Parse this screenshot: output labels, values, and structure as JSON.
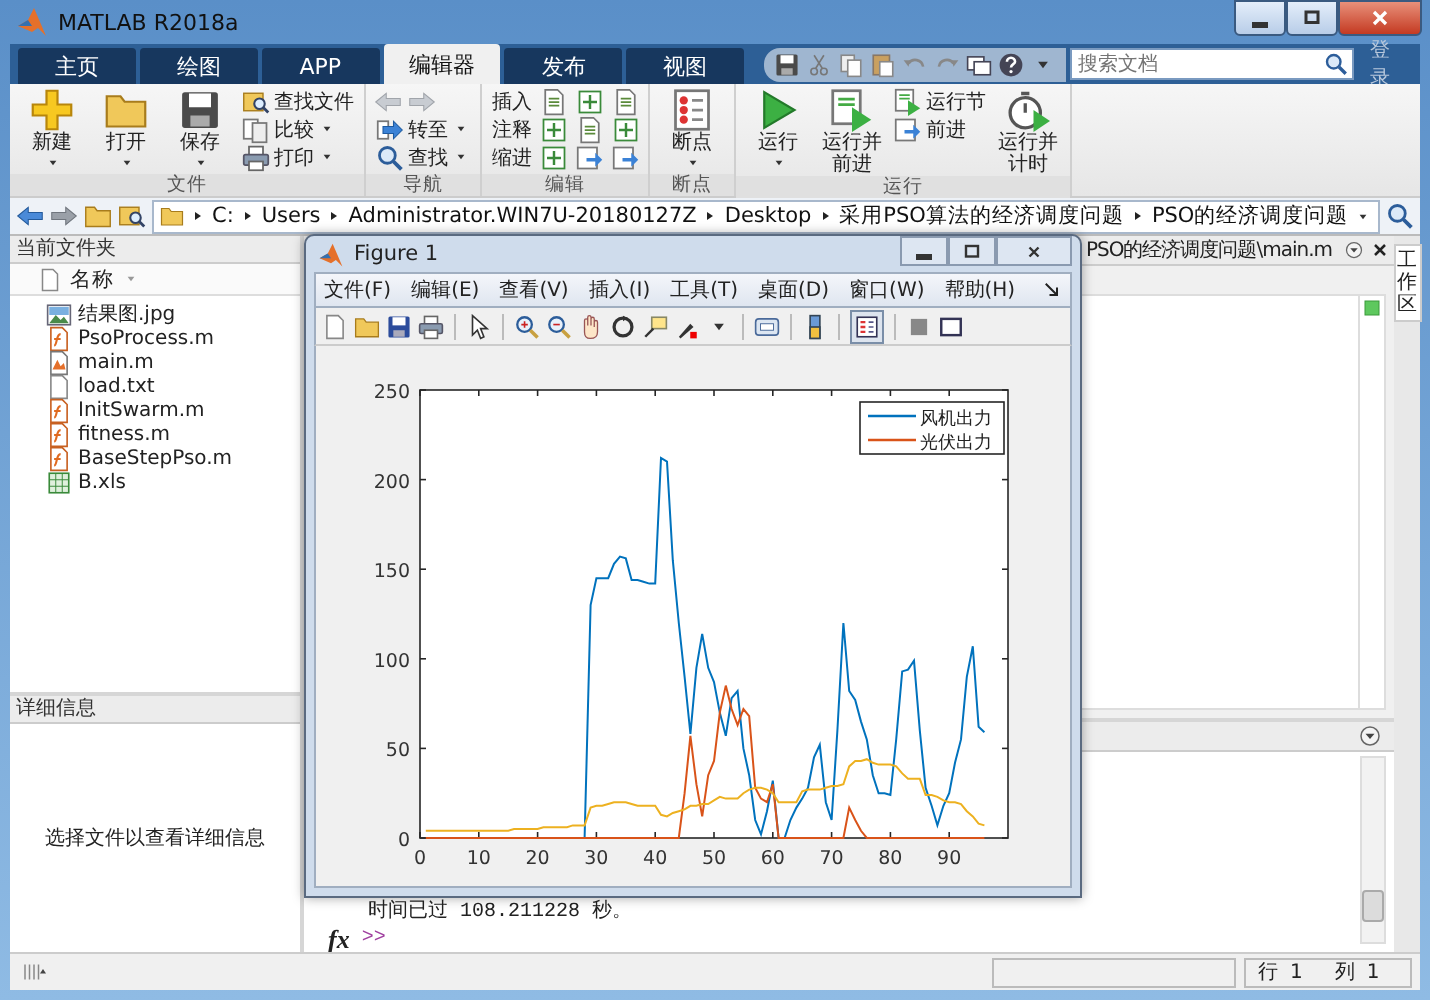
{
  "window": {
    "title": "MATLAB R2018a"
  },
  "tabs": [
    {
      "label": "主页",
      "selected": false
    },
    {
      "label": "绘图",
      "selected": false
    },
    {
      "label": "APP",
      "selected": false
    },
    {
      "label": "编辑器",
      "selected": true
    },
    {
      "label": "发布",
      "selected": false
    },
    {
      "label": "视图",
      "selected": false
    }
  ],
  "search": {
    "placeholder": "搜索文档"
  },
  "login": "登录",
  "ribbon": {
    "groups": [
      {
        "title": "文件",
        "buttons": [
          {
            "label": "新建",
            "kind": "large",
            "menu": true
          },
          {
            "label": "打开",
            "kind": "large",
            "menu": true
          },
          {
            "label": "保存",
            "kind": "large",
            "menu": true
          },
          {
            "label": "查找文件",
            "kind": "small",
            "menu": false
          },
          {
            "label": "比较",
            "kind": "small",
            "menu": true
          },
          {
            "label": "打印",
            "kind": "small",
            "menu": true
          }
        ]
      },
      {
        "title": "导航",
        "buttons": [
          {
            "label": "转至",
            "kind": "small",
            "menu": true
          },
          {
            "label": "查找",
            "kind": "small",
            "menu": true
          }
        ]
      },
      {
        "title": "编辑",
        "buttons": [
          {
            "label": "插入",
            "kind": "text",
            "menu": false
          },
          {
            "label": "注释",
            "kind": "text",
            "menu": false
          },
          {
            "label": "缩进",
            "kind": "text",
            "menu": false
          }
        ]
      },
      {
        "title": "断点",
        "buttons": [
          {
            "label": "断点",
            "kind": "large",
            "menu": true
          }
        ]
      },
      {
        "title": "运行",
        "buttons": [
          {
            "label": "运行",
            "kind": "large",
            "menu": true
          },
          {
            "label": "运行并前进",
            "kind": "large",
            "menu": false
          },
          {
            "label": "运行节",
            "kind": "small",
            "menu": false
          },
          {
            "label": "前进",
            "kind": "small",
            "menu": false
          },
          {
            "label": "运行并计时",
            "kind": "large",
            "menu": false
          }
        ]
      }
    ]
  },
  "address": [
    "C:",
    "Users",
    "Administrator.WIN7U-20180127Z",
    "Desktop",
    "采用PSO算法的经济调度问题",
    "PSO的经济调度问题"
  ],
  "current_folder": {
    "title": "当前文件夹",
    "column": "名称",
    "files": [
      {
        "name": "结果图.jpg",
        "kind": "image"
      },
      {
        "name": "PsoProcess.m",
        "kind": "function"
      },
      {
        "name": "main.m",
        "kind": "script"
      },
      {
        "name": "load.txt",
        "kind": "text"
      },
      {
        "name": "InitSwarm.m",
        "kind": "function"
      },
      {
        "name": "fitness.m",
        "kind": "function"
      },
      {
        "name": "BaseStepPso.m",
        "kind": "function"
      },
      {
        "name": "B.xls",
        "kind": "sheet"
      }
    ]
  },
  "details": {
    "title": "详细信息",
    "message": "选择文件以查看详细信息"
  },
  "editor": {
    "title": "PSO的经济调度问题\\main.m"
  },
  "workspace_tab": "工作区",
  "command_window": {
    "lines": [
      "时间已过 108.211228 秒。"
    ],
    "fx": "fx",
    "prompt": ">>"
  },
  "status_bar": {
    "row_label": "行",
    "row": "1",
    "col_label": "列",
    "col": "1"
  },
  "figure": {
    "title": "Figure 1",
    "menu": [
      "文件(F)",
      "编辑(E)",
      "查看(V)",
      "插入(I)",
      "工具(T)",
      "桌面(D)",
      "窗口(W)",
      "帮助(H)"
    ],
    "legend_button": {
      "selected": true
    },
    "chart_data": {
      "type": "line",
      "x": [
        1,
        2,
        3,
        4,
        5,
        6,
        7,
        8,
        9,
        10,
        11,
        12,
        13,
        14,
        15,
        16,
        17,
        18,
        19,
        20,
        21,
        22,
        23,
        24,
        25,
        26,
        27,
        28,
        29,
        30,
        31,
        32,
        33,
        34,
        35,
        36,
        37,
        38,
        39,
        40,
        41,
        42,
        43,
        44,
        45,
        46,
        47,
        48,
        49,
        50,
        51,
        52,
        53,
        54,
        55,
        56,
        57,
        58,
        59,
        60,
        61,
        62,
        63,
        64,
        65,
        66,
        67,
        68,
        69,
        70,
        71,
        72,
        73,
        74,
        75,
        76,
        77,
        78,
        79,
        80,
        81,
        82,
        83,
        84,
        85,
        86,
        87,
        88,
        89,
        90,
        91,
        92,
        93,
        94,
        95,
        96
      ],
      "series": [
        {
          "name": "风机出力",
          "color": "#0072bd",
          "values": [
            null,
            null,
            null,
            null,
            null,
            null,
            null,
            null,
            null,
            null,
            null,
            null,
            null,
            null,
            null,
            null,
            null,
            null,
            null,
            null,
            null,
            null,
            null,
            null,
            null,
            null,
            null,
            0,
            130,
            145,
            145,
            145,
            153,
            157,
            156,
            144,
            144,
            143,
            142,
            142,
            212,
            210,
            155,
            120,
            90,
            58,
            95,
            114,
            95,
            87,
            70,
            57,
            78,
            82,
            50,
            35,
            10,
            2,
            15,
            32,
            0,
            0,
            10,
            17,
            22,
            28,
            45,
            52,
            20,
            10,
            60,
            120,
            82,
            77,
            65,
            55,
            35,
            25,
            25,
            24,
            55,
            93,
            94,
            99,
            60,
            28,
            18,
            7,
            18,
            25,
            42,
            55,
            90,
            107,
            62,
            59
          ]
        },
        {
          "name": "光伏出力",
          "color": "#d95319",
          "values": [
            0,
            0,
            0,
            0,
            0,
            0,
            0,
            0,
            0,
            0,
            0,
            0,
            0,
            0,
            0,
            0,
            0,
            0,
            0,
            0,
            0,
            0,
            0,
            0,
            0,
            0,
            0,
            0,
            0,
            0,
            0,
            0,
            0,
            0,
            0,
            0,
            0,
            0,
            0,
            0,
            0,
            0,
            0,
            0,
            25,
            57,
            30,
            12,
            35,
            43,
            70,
            85,
            72,
            63,
            72,
            68,
            28,
            22,
            20,
            30,
            0,
            0,
            0,
            0,
            0,
            0,
            0,
            0,
            0,
            0,
            0,
            0,
            17,
            10,
            4,
            0,
            0,
            0,
            0,
            0,
            0,
            0,
            0,
            0,
            0,
            0,
            0,
            0,
            0,
            0,
            0,
            0,
            0,
            0,
            0,
            0
          ]
        },
        {
          "color": "#edb120",
          "values": [
            4,
            4,
            4,
            4,
            4,
            4,
            4,
            4,
            4,
            4,
            4,
            4,
            4,
            4,
            4,
            5,
            5,
            5,
            5,
            5,
            6,
            6,
            6,
            6,
            6,
            7,
            7,
            7,
            17,
            18,
            18,
            19,
            20,
            20,
            20,
            19,
            18,
            18,
            18,
            18,
            13,
            12,
            14,
            15,
            16,
            18,
            18,
            19,
            19,
            21,
            23,
            22,
            22,
            22,
            25,
            27,
            28,
            28,
            27,
            25,
            20,
            20,
            20,
            20,
            26,
            27,
            27,
            27,
            28,
            29,
            29,
            30,
            40,
            43,
            43,
            44,
            42,
            41,
            41,
            41,
            40,
            36,
            33,
            33,
            33,
            24,
            24,
            23,
            21,
            20,
            20,
            19,
            15,
            12,
            8,
            7
          ]
        }
      ],
      "legend": true,
      "xlim": [
        0,
        100
      ],
      "ylim": [
        0,
        250
      ],
      "xticks": [
        0,
        10,
        20,
        30,
        40,
        50,
        60,
        70,
        80,
        90
      ],
      "yticks": [
        0,
        50,
        100,
        150,
        200,
        250
      ]
    }
  }
}
